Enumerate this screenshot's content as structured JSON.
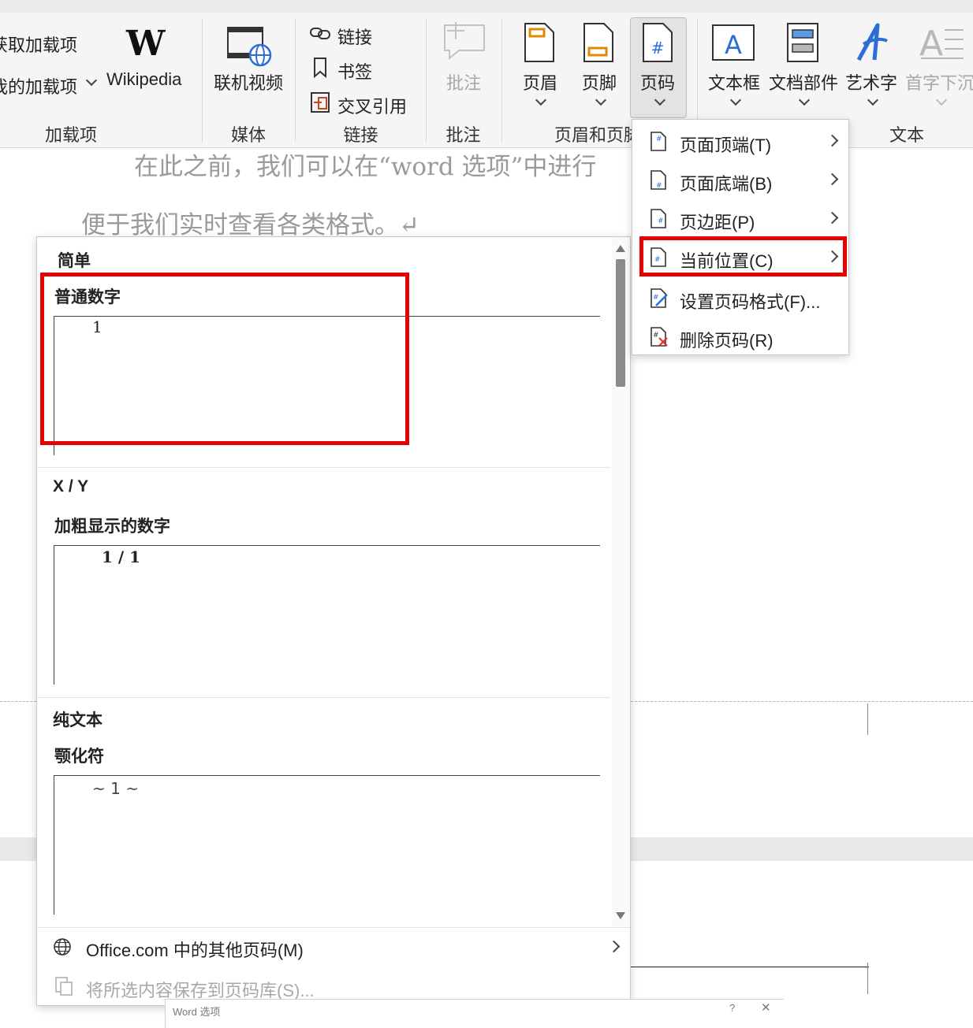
{
  "ribbon": {
    "addins": {
      "item1": "获取加载项",
      "item2": "我的加载项",
      "wikipedia": "Wikipedia",
      "group": "加载项"
    },
    "media": {
      "online_video": "联机视频",
      "group": "媒体"
    },
    "links": {
      "link": "链接",
      "bookmark": "书签",
      "cross_ref": "交叉引用",
      "group": "链接"
    },
    "comments": {
      "comment": "批注",
      "group": "批注"
    },
    "header_footer": {
      "header": "页眉",
      "footer": "页脚",
      "page_number": "页码",
      "group": "页眉和页脚"
    },
    "text": {
      "textbox": "文本框",
      "quick_parts": "文档部件",
      "wordart": "艺术字",
      "dropcap": "首字下沉",
      "group": "文本"
    }
  },
  "document": {
    "line1": "在此之前，我们可以在“word 选项”中进行",
    "line2": "便于我们实时查看各类格式。↵"
  },
  "gallery": {
    "sections": [
      {
        "heading": "简单",
        "item_title": "普通数字",
        "sample": "1"
      },
      {
        "heading": "X / Y",
        "item_title": "加粗显示的数字",
        "sample": "1 / 1"
      },
      {
        "heading": "纯文本",
        "item_title": "颚化符",
        "sample": "~ 1 ~"
      }
    ],
    "footer": {
      "more": "Office.com 中的其他页码(M)",
      "save": "将所选内容保存到页码库(S)..."
    }
  },
  "page_number_menu": {
    "items": [
      {
        "label": "页面顶端(T)",
        "submenu": true
      },
      {
        "label": "页面底端(B)",
        "submenu": true
      },
      {
        "label": "页边距(P)",
        "submenu": true
      },
      {
        "label": "当前位置(C)",
        "submenu": true
      },
      {
        "label": "设置页码格式(F)...",
        "submenu": false
      },
      {
        "label": "删除页码(R)",
        "submenu": false
      }
    ]
  },
  "dialog_peek": {
    "title": "Word 选项",
    "help": "?",
    "close": "✕"
  },
  "colors": {
    "highlight": "#e60000",
    "accent_blue": "#2b6fd6",
    "ribbon_bg": "#f5f5f5"
  }
}
